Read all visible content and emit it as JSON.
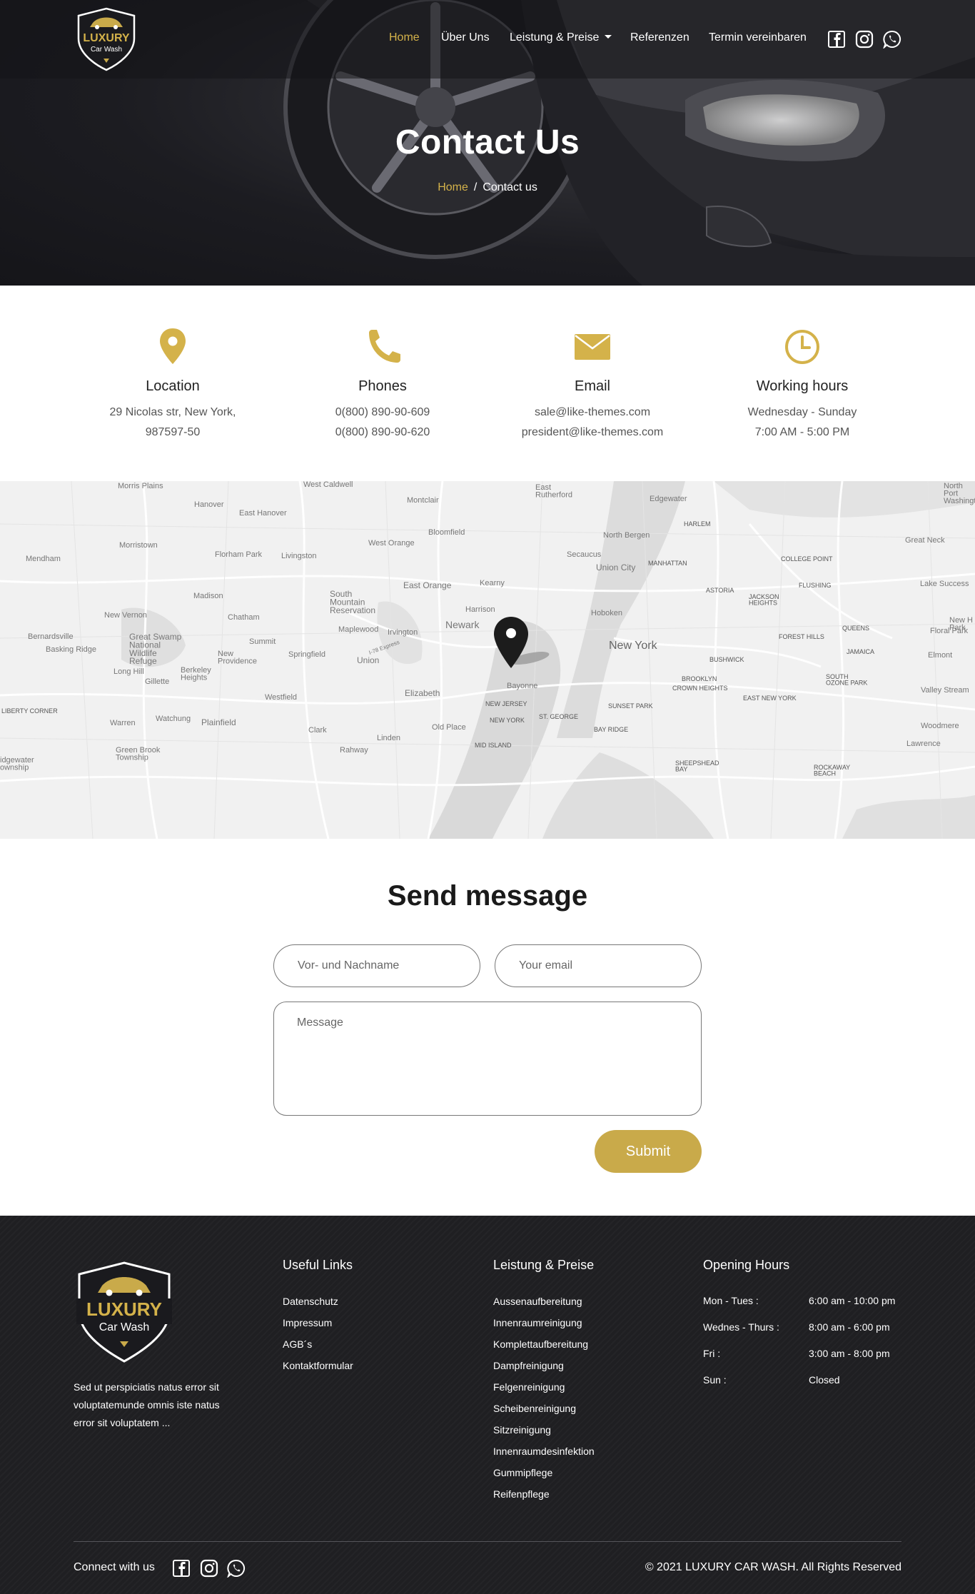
{
  "brand": {
    "name": "LUXURY",
    "tagline": "Car Wash",
    "gold": "#c9aa4a",
    "dark": "#1f1f22"
  },
  "nav": {
    "items": [
      {
        "label": "Home",
        "active": true
      },
      {
        "label": "Über Uns"
      },
      {
        "label": "Leistung & Preise",
        "dropdown": true
      },
      {
        "label": "Referenzen"
      },
      {
        "label": "Termin vereinbaren"
      }
    ],
    "social_icons": [
      "facebook-icon",
      "instagram-icon",
      "whatsapp-icon"
    ]
  },
  "hero": {
    "title": "Contact Us",
    "breadcrumb": {
      "home": "Home",
      "separator": "/",
      "current": "Contact us"
    }
  },
  "info": [
    {
      "icon": "location-pin-icon",
      "title": "Location",
      "lines": [
        "29 Nicolas str, New York,",
        "987597-50"
      ]
    },
    {
      "icon": "phone-icon",
      "title": "Phones",
      "lines": [
        "0(800) 890-90-609",
        "0(800) 890-90-620"
      ]
    },
    {
      "icon": "email-icon",
      "title": "Email",
      "lines": [
        "sale@like-themes.com",
        "president@like-themes.com"
      ]
    },
    {
      "icon": "clock-icon",
      "title": "Working hours",
      "lines": [
        "Wednesday - Sunday",
        "7:00 AM - 5:00 PM"
      ]
    }
  ],
  "map": {
    "marker_icon": "map-marker-icon",
    "labels": {
      "morris_plains": "Morris Plains",
      "west_caldwell": "West Caldwell",
      "east_rutherford": "East\nRutherford",
      "hanover": "Hanover",
      "east_hanover": "East Hanover",
      "montclair": "Montclair",
      "edgewater": "Edgewater",
      "morristown": "Morristown",
      "bloomfield": "Bloomfield",
      "north_bergen": "North Bergen",
      "harlem": "HARLEM",
      "mendham": "Mendham",
      "florham_park": "Florham Park",
      "livingston": "Livingston",
      "west_orange": "West Orange",
      "secaucus": "Secaucus",
      "union_city": "Union City",
      "manhattan": "MANHATTAN",
      "college_point": "COLLEGE POINT",
      "great_neck": "Great Neck",
      "madison": "Madison",
      "east_orange": "East Orange",
      "kearny": "Kearny",
      "astoria": "ASTORIA",
      "flushing": "FLUSHING",
      "jackson_heights": "JACKSON\nHEIGHTS",
      "lake_success": "Lake Success",
      "new_vernon": "New Vernon",
      "chatham": "Chatham",
      "south_mountain": "South\nMountain\nReservation",
      "harrison": "Harrison",
      "hoboken": "Hoboken",
      "newark": "Newark",
      "maplewood": "Maplewood",
      "irvington": "Irvington",
      "bernardsville": "Bernardsville",
      "great_swamp": "Great Swamp\nNational\nWildlife\nRefuge",
      "summit": "Summit",
      "new_york": "New York",
      "forest_hills": "FOREST HILLS",
      "queens": "QUEENS",
      "floral_park": "Floral Park",
      "basking_ridge": "Basking Ridge",
      "springfield": "Springfield",
      "union": "Union",
      "new_providence": "New\nProvidence",
      "jamaica": "JAMAICA",
      "elmont": "Elmont",
      "bushwick": "BUSHWICK",
      "long_hill": "Long Hill",
      "berkeley_heights": "Berkeley\nHeights",
      "gillette": "Gillette",
      "bayonne": "Bayonne",
      "brooklyn": "BROOKLYN",
      "crown_heights": "CROWN HEIGHTS",
      "south_ozone_park": "SOUTH\nOZONE PARK",
      "valley_stream": "Valley Stream",
      "westfield": "Westfield",
      "elizabeth": "Elizabeth",
      "new_jersey": "NEW JERSEY",
      "sunset_park": "SUNSET PARK",
      "east_new_york": "EAST NEW YORK",
      "liberty_corner": "LIBERTY CORNER",
      "warren": "Warren",
      "watchung": "Watchung",
      "plainfield": "Plainfield",
      "new_york_small": "NEW YORK",
      "st_george": "ST. GEORGE",
      "woodmere": "Woodmere",
      "clark": "Clark",
      "old_place": "Old Place",
      "bay_ridge": "BAY RIDGE",
      "linden": "Linden",
      "lawrence": "Lawrence",
      "green_brook": "Green Brook\nTownship",
      "rahway": "Rahway",
      "mid_island": "MID ISLAND",
      "sheepshead_bay": "SHEEPSHEAD\nBAY",
      "rockaway_beach": "ROCKAWAY\nBEACH",
      "bridgewater": "idgewater\nownship",
      "north_port": "North\nPort\nWashingto",
      "new_hyde_park": "New H\nPark",
      "i78": "I-78 Express"
    }
  },
  "form": {
    "title": "Send message",
    "name_placeholder": "Vor- und Nachname",
    "email_placeholder": "Your email",
    "message_placeholder": "Message",
    "submit_label": "Submit"
  },
  "footer": {
    "description": "Sed ut perspiciatis natus error sit voluptatemunde omnis iste natus error sit voluptatem ...",
    "useful_links": {
      "heading": "Useful Links",
      "items": [
        "Datenschutz",
        "Impressum",
        "AGB´s",
        "Kontaktformular"
      ]
    },
    "services": {
      "heading": "Leistung & Preise",
      "items": [
        "Aussenaufbereitung",
        "Innenraumreinigung",
        "Komplettaufbereitung",
        "Dampfreinigung",
        "Felgenreinigung",
        "Scheibenreinigung",
        "Sitzreinigung",
        "Innenraumdesinfektion",
        "Gummipflege",
        "Reifenpflege"
      ]
    },
    "hours": {
      "heading": "Opening Hours",
      "rows": [
        {
          "day": "Mon - Tues :",
          "time": "6:00 am - 10:00 pm"
        },
        {
          "day": "Wednes - Thurs :",
          "time": "8:00 am - 6:00 pm"
        },
        {
          "day": "Fri :",
          "time": "3:00 am - 8:00 pm"
        },
        {
          "day": "Sun :",
          "time": "Closed"
        }
      ]
    },
    "connect_label": "Connect with us",
    "copyright": "© 2021 LUXURY CAR WASH. All Rights Reserved"
  }
}
